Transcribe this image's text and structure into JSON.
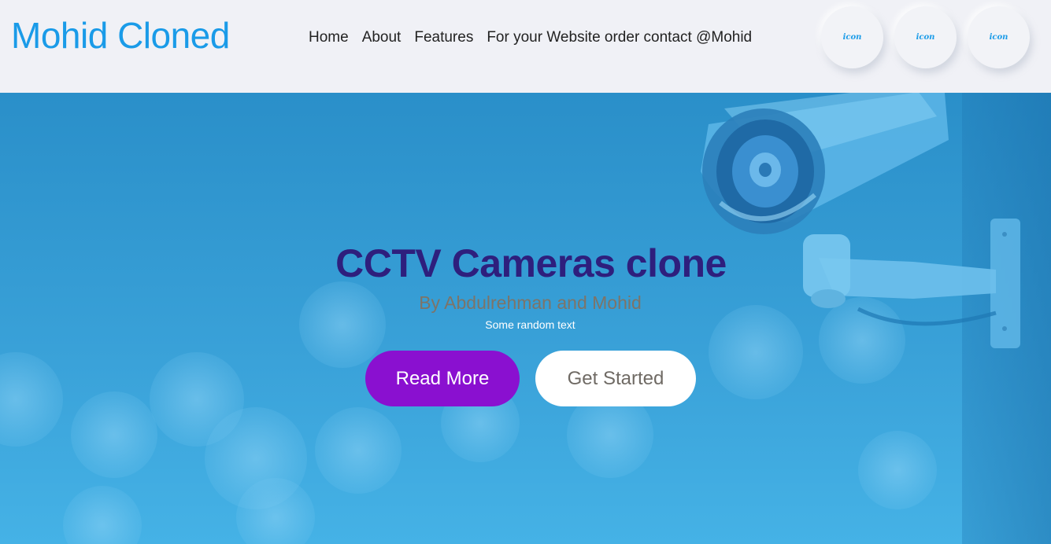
{
  "header": {
    "brand": "Mohid Cloned",
    "nav": [
      "Home",
      "About",
      "Features",
      "For your Website order contact @Mohid"
    ],
    "icon_buttons": [
      "icon",
      "icon",
      "icon"
    ]
  },
  "hero": {
    "title": "CCTV Cameras clone",
    "subtitle": "By Abdulrehman and Mohid",
    "small_text": "Some random text",
    "primary_button": "Read More",
    "secondary_button": "Get Started",
    "background_image": "cctv-camera-icon"
  },
  "colors": {
    "brand": "#1a9be8",
    "title": "#2e1f7d",
    "primary_button": "#8a10d0",
    "hero_background": "#3aa2d9"
  }
}
